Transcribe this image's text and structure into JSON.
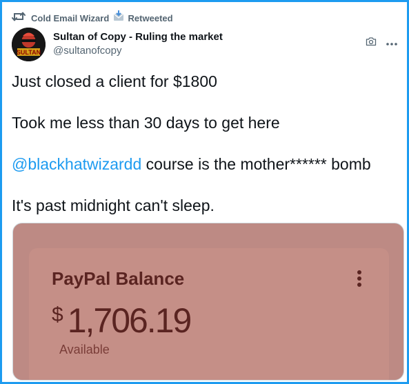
{
  "retweet": {
    "user": "Cold Email Wizard",
    "label": "Retweeted"
  },
  "author": {
    "name": "Sultan of Copy - Ruling the market",
    "handle": "@sultanofcopy",
    "avatar_text": "SULTAN"
  },
  "tweet": {
    "line1": "Just closed a client for $1800",
    "line2": "Took me less than 30 days to get here",
    "mention": "@blackhatwizardd",
    "line3_rest": " course is the mother****** bomb",
    "line4": "It's past midnight can't sleep."
  },
  "media": {
    "title": "PayPal Balance",
    "currency": "$",
    "amount": "1,706.19",
    "subtitle": "Available"
  },
  "colors": {
    "accent": "#1d9bf0",
    "card": "#c58f87",
    "card_text": "#5a2421"
  },
  "icons": [
    "retweet-icon",
    "mail-icon",
    "camera-icon",
    "more-icon",
    "kebab-menu-icon"
  ]
}
